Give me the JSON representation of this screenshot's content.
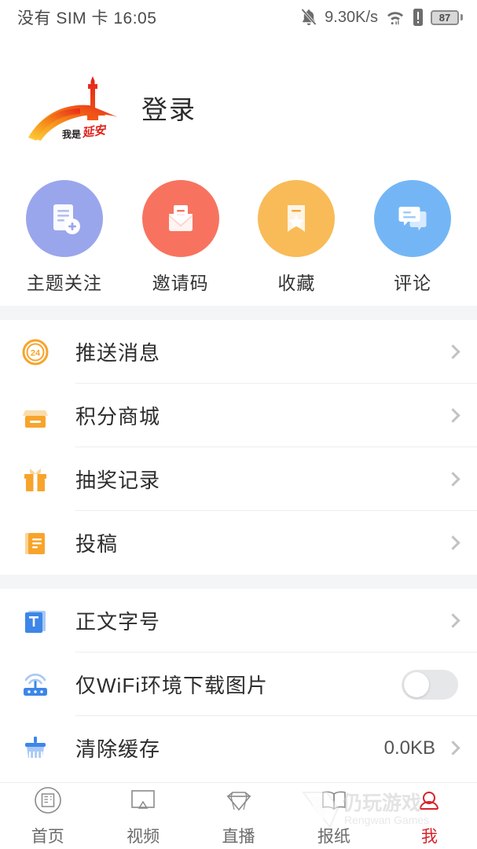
{
  "status_bar": {
    "carrier": "没有 SIM 卡 16:05",
    "network_speed": "9.30K/s",
    "battery_level": "87",
    "icons": [
      "bell-muted-icon",
      "wifi-icon",
      "alert-icon",
      "battery-icon"
    ]
  },
  "header": {
    "logo_name": "yanan-pagoda-logo",
    "logo_text": "我是延安",
    "login_label": "登录"
  },
  "quick_actions": [
    {
      "label": "主题关注",
      "icon": "document-add-icon",
      "color": "#9aa6ec"
    },
    {
      "label": "邀请码",
      "icon": "envelope-icon",
      "color": "#f7735f"
    },
    {
      "label": "收藏",
      "icon": "bookmark-star-icon",
      "color": "#f8bb57"
    },
    {
      "label": "评论",
      "icon": "chat-bubbles-icon",
      "color": "#74b6f5"
    }
  ],
  "sections": [
    {
      "rows": [
        {
          "label": "推送消息",
          "icon": "badge-24-icon",
          "value": "",
          "control": "chevron"
        },
        {
          "label": "积分商城",
          "icon": "shop-icon",
          "value": "",
          "control": "chevron"
        },
        {
          "label": "抽奖记录",
          "icon": "gift-icon",
          "value": "",
          "control": "chevron"
        },
        {
          "label": "投稿",
          "icon": "notebook-icon",
          "value": "",
          "control": "chevron"
        }
      ]
    },
    {
      "rows": [
        {
          "label": "正文字号",
          "icon": "font-size-icon",
          "value": "",
          "control": "chevron"
        },
        {
          "label": "仅WiFi环境下载图片",
          "icon": "router-icon",
          "value": "",
          "control": "toggle-off"
        },
        {
          "label": "清除缓存",
          "icon": "broom-icon",
          "value": "0.0KB",
          "control": "chevron"
        }
      ]
    }
  ],
  "tab_bar": {
    "active_color": "#d8232a",
    "tabs": [
      {
        "label": "首页",
        "icon": "home-news-icon",
        "active": false
      },
      {
        "label": "视频",
        "icon": "video-icon",
        "active": false
      },
      {
        "label": "直播",
        "icon": "diamond-icon",
        "active": false
      },
      {
        "label": "报纸",
        "icon": "newspaper-icon",
        "active": false
      },
      {
        "label": "我",
        "icon": "person-icon",
        "active": true
      }
    ]
  },
  "watermark": {
    "title": "仍玩游戏",
    "subtitle": "Rengwan Games"
  }
}
